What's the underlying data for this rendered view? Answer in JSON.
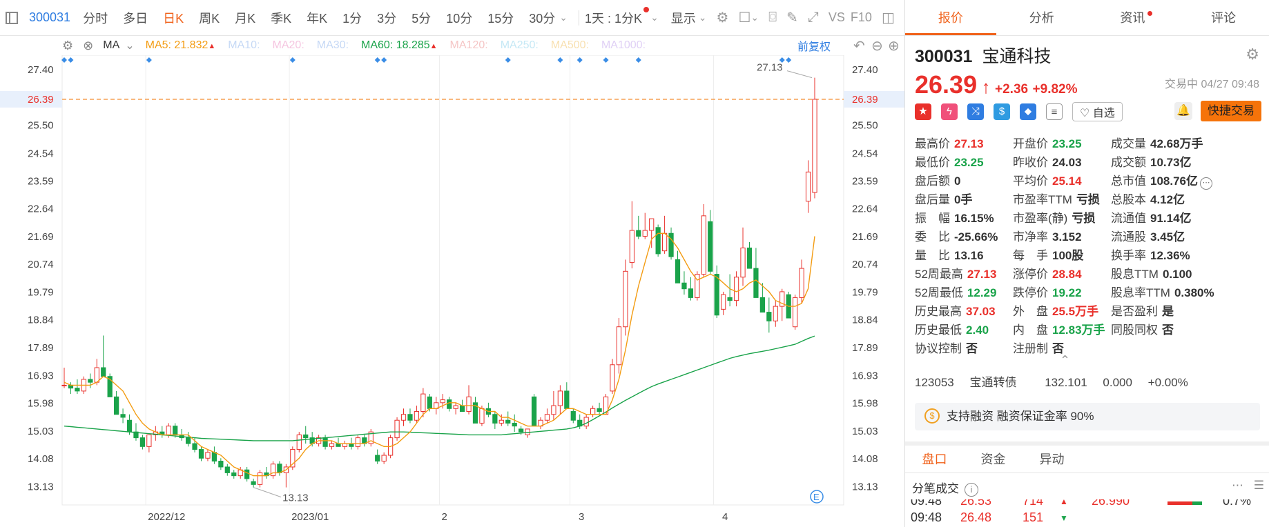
{
  "toolbar": {
    "code": "300031",
    "tabs": [
      "分时",
      "多日",
      "日K",
      "周K",
      "月K",
      "季K",
      "年K",
      "1分",
      "3分",
      "5分",
      "10分",
      "15分",
      "30分"
    ],
    "active_tab": "日K",
    "period_select": "1天 : 1分K",
    "display_label": "显示",
    "vs_label": "VS",
    "f10_label": "F10"
  },
  "ma_bar": {
    "ma_label": "MA",
    "items": [
      {
        "label": "MA5:",
        "value": "21.832",
        "color": "#f39c12",
        "arrow": "▲"
      },
      {
        "label": "MA10:",
        "value": "",
        "color": "#c5d8f5",
        "arrow": ""
      },
      {
        "label": "MA20:",
        "value": "",
        "color": "#f5c5e0",
        "arrow": ""
      },
      {
        "label": "MA30:",
        "value": "",
        "color": "#c5d8f5",
        "arrow": ""
      },
      {
        "label": "MA60:",
        "value": "18.285",
        "color": "#1aa34a",
        "arrow": "▲"
      },
      {
        "label": "MA120:",
        "value": "",
        "color": "#f5c5c5",
        "arrow": ""
      },
      {
        "label": "MA250:",
        "value": "",
        "color": "#c5e8f5",
        "arrow": ""
      },
      {
        "label": "MA500:",
        "value": "",
        "color": "#f8e0b0",
        "arrow": ""
      },
      {
        "label": "MA1000:",
        "value": "",
        "color": "#e0d0f5",
        "arrow": ""
      }
    ],
    "adjust_label": "前复权"
  },
  "chart_data": {
    "type": "candlestick",
    "y_ticks": [
      "27.40",
      "26.39",
      "25.50",
      "24.54",
      "23.59",
      "22.64",
      "21.69",
      "20.74",
      "19.79",
      "18.84",
      "17.89",
      "16.93",
      "15.98",
      "15.03",
      "14.08",
      "13.13"
    ],
    "ylim": [
      12.5,
      27.9
    ],
    "x_labels": [
      "2022/12",
      "2023/01",
      "2",
      "3",
      "4"
    ],
    "current_price": "26.39",
    "max_label": "27.13",
    "min_label": "13.13",
    "candles": [
      [
        16.6,
        17.2,
        16.5,
        16.6
      ],
      [
        16.6,
        16.7,
        16.3,
        16.5
      ],
      [
        16.5,
        16.8,
        16.3,
        16.4
      ],
      [
        16.4,
        16.9,
        16.3,
        16.8
      ],
      [
        16.8,
        17.0,
        16.5,
        16.7
      ],
      [
        16.7,
        17.5,
        16.6,
        17.2
      ],
      [
        17.2,
        18.3,
        16.9,
        16.9
      ],
      [
        16.9,
        17.0,
        16.2,
        16.2
      ],
      [
        16.2,
        16.4,
        15.6,
        15.6
      ],
      [
        15.6,
        15.8,
        15.3,
        15.5
      ],
      [
        15.4,
        15.6,
        14.9,
        15.0
      ],
      [
        15.0,
        15.3,
        14.7,
        14.8
      ],
      [
        14.8,
        14.9,
        14.4,
        14.5
      ],
      [
        14.5,
        14.9,
        14.3,
        14.9
      ],
      [
        14.9,
        15.2,
        14.7,
        15.0
      ],
      [
        15.0,
        15.2,
        14.8,
        14.9
      ],
      [
        14.9,
        15.3,
        14.8,
        15.2
      ],
      [
        15.2,
        15.3,
        14.8,
        14.9
      ],
      [
        14.9,
        15.1,
        14.7,
        14.8
      ],
      [
        14.8,
        15.0,
        14.5,
        14.6
      ],
      [
        14.6,
        14.8,
        14.3,
        14.4
      ],
      [
        14.4,
        14.5,
        14.0,
        14.1
      ],
      [
        14.1,
        14.4,
        14.0,
        14.3
      ],
      [
        14.3,
        14.5,
        13.9,
        14.0
      ],
      [
        14.0,
        14.1,
        13.7,
        13.8
      ],
      [
        13.8,
        13.9,
        13.5,
        13.6
      ],
      [
        13.6,
        13.7,
        13.4,
        13.5
      ],
      [
        13.5,
        13.8,
        13.4,
        13.7
      ],
      [
        13.7,
        13.8,
        13.3,
        13.4
      ],
      [
        13.3,
        13.4,
        13.1,
        13.2
      ],
      [
        13.2,
        13.7,
        13.1,
        13.6
      ],
      [
        13.6,
        13.8,
        13.4,
        13.5
      ],
      [
        13.5,
        14.0,
        13.4,
        13.9
      ],
      [
        13.9,
        14.0,
        13.5,
        13.6
      ],
      [
        13.6,
        13.9,
        13.1,
        13.8
      ],
      [
        13.8,
        14.5,
        13.7,
        14.4
      ],
      [
        14.4,
        15.0,
        14.3,
        14.9
      ],
      [
        14.9,
        15.2,
        14.6,
        14.8
      ],
      [
        14.8,
        15.0,
        14.5,
        14.6
      ],
      [
        14.6,
        14.9,
        14.5,
        14.8
      ],
      [
        14.8,
        14.9,
        14.4,
        14.5
      ],
      [
        14.5,
        14.7,
        14.4,
        14.6
      ],
      [
        14.6,
        14.8,
        14.5,
        14.5
      ],
      [
        14.5,
        14.7,
        14.4,
        14.6
      ],
      [
        14.6,
        14.8,
        14.4,
        14.5
      ],
      [
        14.5,
        14.9,
        14.4,
        14.8
      ],
      [
        14.8,
        14.9,
        14.5,
        14.6
      ],
      [
        14.6,
        15.1,
        14.5,
        15.0
      ],
      [
        14.2,
        14.4,
        13.9,
        14.0
      ],
      [
        14.0,
        14.3,
        13.9,
        14.2
      ],
      [
        14.2,
        14.9,
        14.1,
        14.8
      ],
      [
        14.8,
        15.5,
        14.7,
        15.4
      ],
      [
        15.4,
        15.8,
        15.2,
        15.6
      ],
      [
        15.6,
        15.8,
        15.3,
        15.4
      ],
      [
        15.4,
        15.9,
        15.3,
        15.7
      ],
      [
        15.7,
        16.5,
        15.5,
        16.3
      ],
      [
        16.2,
        16.3,
        15.7,
        15.8
      ],
      [
        15.8,
        16.2,
        15.6,
        16.0
      ],
      [
        16.0,
        16.3,
        15.8,
        16.1
      ],
      [
        16.1,
        16.2,
        15.7,
        15.8
      ],
      [
        15.8,
        16.0,
        15.6,
        15.9
      ],
      [
        15.9,
        16.1,
        15.7,
        15.7
      ],
      [
        15.7,
        16.6,
        15.6,
        16.2
      ],
      [
        16.0,
        16.2,
        15.3,
        15.3
      ],
      [
        15.3,
        15.9,
        15.2,
        15.8
      ],
      [
        15.8,
        16.0,
        15.5,
        15.6
      ],
      [
        15.6,
        15.7,
        15.1,
        15.3
      ],
      [
        15.3,
        15.6,
        15.2,
        15.4
      ],
      [
        15.4,
        15.7,
        15.2,
        15.3
      ],
      [
        15.3,
        15.6,
        15.0,
        15.2
      ],
      [
        15.1,
        15.2,
        14.9,
        15.0
      ],
      [
        14.9,
        15.1,
        14.8,
        15.1
      ],
      [
        16.2,
        16.3,
        15.2,
        15.2
      ],
      [
        15.2,
        15.5,
        15.1,
        15.4
      ],
      [
        15.4,
        15.8,
        15.3,
        15.6
      ],
      [
        15.6,
        16.4,
        15.4,
        15.9
      ],
      [
        15.9,
        16.6,
        15.6,
        16.4
      ],
      [
        16.4,
        16.7,
        15.8,
        15.8
      ],
      [
        15.7,
        15.8,
        15.3,
        15.4
      ],
      [
        15.4,
        15.6,
        15.1,
        15.2
      ],
      [
        15.2,
        15.6,
        15.1,
        15.5
      ],
      [
        15.6,
        15.9,
        15.5,
        15.8
      ],
      [
        15.8,
        16.0,
        15.6,
        15.7
      ],
      [
        15.6,
        16.3,
        15.6,
        16.2
      ],
      [
        16.4,
        17.5,
        16.3,
        17.3
      ],
      [
        17.3,
        18.9,
        17.0,
        18.6
      ],
      [
        18.6,
        20.9,
        18.3,
        20.5
      ],
      [
        20.8,
        22.9,
        20.6,
        21.9
      ],
      [
        21.9,
        22.4,
        21.6,
        21.7
      ],
      [
        21.7,
        22.5,
        21.6,
        21.9
      ],
      [
        21.9,
        22.3,
        21.3,
        22.3
      ],
      [
        22.0,
        22.1,
        21.0,
        21.1
      ],
      [
        21.2,
        22.4,
        21.1,
        21.8
      ],
      [
        21.8,
        22.0,
        20.9,
        21.0
      ],
      [
        20.9,
        21.2,
        20.1,
        20.1
      ],
      [
        20.1,
        20.5,
        19.7,
        19.9
      ],
      [
        19.9,
        20.3,
        19.5,
        19.6
      ],
      [
        19.6,
        20.5,
        19.5,
        20.4
      ],
      [
        20.4,
        22.8,
        20.3,
        22.4
      ],
      [
        22.2,
        22.6,
        20.4,
        20.5
      ],
      [
        20.4,
        20.7,
        18.9,
        19.0
      ],
      [
        19.2,
        19.8,
        19.0,
        19.7
      ],
      [
        19.6,
        20.4,
        19.3,
        19.5
      ],
      [
        19.5,
        20.5,
        19.3,
        20.3
      ],
      [
        20.3,
        22.0,
        20.0,
        21.3
      ],
      [
        21.3,
        21.5,
        20.6,
        20.6
      ],
      [
        20.6,
        21.3,
        19.6,
        19.6
      ],
      [
        19.6,
        20.1,
        19.1,
        19.1
      ],
      [
        19.1,
        19.6,
        18.4,
        18.8
      ],
      [
        18.8,
        19.5,
        18.6,
        19.3
      ],
      [
        19.3,
        19.9,
        18.8,
        19.8
      ],
      [
        19.7,
        19.8,
        18.9,
        18.9
      ],
      [
        18.6,
        19.7,
        18.5,
        19.6
      ],
      [
        19.6,
        20.9,
        19.4,
        20.6
      ],
      [
        22.9,
        24.3,
        22.5,
        23.9
      ],
      [
        23.2,
        27.13,
        23.0,
        26.39
      ]
    ],
    "ma5": [
      16.7,
      16.6,
      16.6,
      16.6,
      16.6,
      16.7,
      16.9,
      16.8,
      16.6,
      16.4,
      16.0,
      15.6,
      15.3,
      15.1,
      15.0,
      14.9,
      14.9,
      14.9,
      14.9,
      14.9,
      14.7,
      14.5,
      14.4,
      14.3,
      14.2,
      14.0,
      13.8,
      13.7,
      13.6,
      13.5,
      13.5,
      13.5,
      13.6,
      13.6,
      13.7,
      13.9,
      14.1,
      14.4,
      14.6,
      14.7,
      14.7,
      14.7,
      14.6,
      14.6,
      14.6,
      14.6,
      14.6,
      14.7,
      14.6,
      14.5,
      14.5,
      14.6,
      14.8,
      15.0,
      15.3,
      15.6,
      15.8,
      15.8,
      15.9,
      16.0,
      16.0,
      15.9,
      15.9,
      15.9,
      15.8,
      15.7,
      15.7,
      15.5,
      15.5,
      15.4,
      15.3,
      15.2,
      15.2,
      15.2,
      15.3,
      15.4,
      15.6,
      15.8,
      15.8,
      15.7,
      15.6,
      15.6,
      15.6,
      15.6,
      16.1,
      16.8,
      17.8,
      19.0,
      20.0,
      20.8,
      21.6,
      21.8,
      21.8,
      21.6,
      21.3,
      20.9,
      20.5,
      20.2,
      20.3,
      20.4,
      20.3,
      20.1,
      19.9,
      19.8,
      19.9,
      20.1,
      20.2,
      20.0,
      19.8,
      19.5,
      19.4,
      19.3,
      19.3,
      19.4,
      19.9,
      21.7
    ],
    "ma60": [
      15.2,
      15.18,
      15.16,
      15.14,
      15.12,
      15.1,
      15.08,
      15.06,
      15.04,
      15.02,
      15.0,
      14.98,
      14.96,
      14.94,
      14.92,
      14.9,
      14.88,
      14.86,
      14.84,
      14.82,
      14.8,
      14.78,
      14.77,
      14.76,
      14.75,
      14.74,
      14.73,
      14.72,
      14.71,
      14.7,
      14.7,
      14.7,
      14.7,
      14.7,
      14.7,
      14.7,
      14.72,
      14.74,
      14.76,
      14.78,
      14.8,
      14.82,
      14.84,
      14.86,
      14.88,
      14.9,
      14.92,
      14.94,
      14.96,
      14.98,
      15.0,
      15.0,
      15.0,
      14.99,
      14.98,
      14.97,
      14.96,
      14.95,
      14.94,
      14.93,
      14.92,
      14.91,
      14.9,
      14.9,
      14.9,
      14.9,
      14.9,
      14.9,
      14.92,
      14.94,
      14.96,
      14.98,
      15.0,
      15.02,
      15.04,
      15.06,
      15.08,
      15.1,
      15.14,
      15.2,
      15.3,
      15.42,
      15.55,
      15.68,
      15.82,
      15.95,
      16.08,
      16.2,
      16.32,
      16.44,
      16.55,
      16.64,
      16.72,
      16.8,
      16.88,
      16.96,
      17.04,
      17.12,
      17.2,
      17.28,
      17.36,
      17.44,
      17.52,
      17.58,
      17.63,
      17.68,
      17.72,
      17.76,
      17.8,
      17.85,
      17.9,
      17.95,
      18.0,
      18.1,
      18.2,
      18.285
    ]
  },
  "panel": {
    "tabs": [
      "报价",
      "分析",
      "资讯",
      "评论"
    ],
    "code": "300031",
    "name": "宝通科技",
    "price": "26.39",
    "arrow": "↑",
    "change": "+2.36",
    "change_pct": "+9.82%",
    "status": "交易中 04/27 09:48",
    "fav_label": "自选",
    "trade_label": "快捷交易",
    "stats": [
      [
        {
          "k": "最高价",
          "v": "27.13",
          "c": "red"
        },
        {
          "k": "开盘价",
          "v": "23.25",
          "c": "green"
        },
        {
          "k": "成交量",
          "v": "42.68万手",
          "c": ""
        }
      ],
      [
        {
          "k": "最低价",
          "v": "23.25",
          "c": "green"
        },
        {
          "k": "昨收价",
          "v": "24.03",
          "c": ""
        },
        {
          "k": "成交额",
          "v": "10.73亿",
          "c": ""
        }
      ],
      [
        {
          "k": "盘后额",
          "v": "0",
          "c": ""
        },
        {
          "k": "平均价",
          "v": "25.14",
          "c": "red"
        },
        {
          "k": "总市值",
          "v": "108.76亿",
          "c": ""
        }
      ],
      [
        {
          "k": "盘后量",
          "v": "0手",
          "c": ""
        },
        {
          "k": "市盈率TTM",
          "v": "亏损",
          "c": ""
        },
        {
          "k": "总股本",
          "v": "4.12亿",
          "c": ""
        }
      ],
      [
        {
          "k": "振　幅",
          "v": "16.15%",
          "c": ""
        },
        {
          "k": "市盈率(静)",
          "v": "亏损",
          "c": ""
        },
        {
          "k": "流通值",
          "v": "91.14亿",
          "c": ""
        }
      ],
      [
        {
          "k": "委　比",
          "v": "-25.66%",
          "c": ""
        },
        {
          "k": "市净率",
          "v": "3.152",
          "c": ""
        },
        {
          "k": "流通股",
          "v": "3.45亿",
          "c": ""
        }
      ],
      [
        {
          "k": "量　比",
          "v": "13.16",
          "c": ""
        },
        {
          "k": "每　手",
          "v": "100股",
          "c": ""
        },
        {
          "k": "换手率",
          "v": "12.36%",
          "c": ""
        }
      ],
      [
        {
          "k": "52周最高",
          "v": "27.13",
          "c": "red"
        },
        {
          "k": "涨停价",
          "v": "28.84",
          "c": "red"
        },
        {
          "k": "股息TTM",
          "v": "0.100",
          "c": ""
        }
      ],
      [
        {
          "k": "52周最低",
          "v": "12.29",
          "c": "green"
        },
        {
          "k": "跌停价",
          "v": "19.22",
          "c": "green"
        },
        {
          "k": "股息率TTM",
          "v": "0.380%",
          "c": ""
        }
      ],
      [
        {
          "k": "历史最高",
          "v": "37.03",
          "c": "red"
        },
        {
          "k": "外　盘",
          "v": "25.5万手",
          "c": "red"
        },
        {
          "k": "是否盈利",
          "v": "是",
          "c": ""
        }
      ],
      [
        {
          "k": "历史最低",
          "v": "2.40",
          "c": "green"
        },
        {
          "k": "内　盘",
          "v": "12.83万手",
          "c": "green"
        },
        {
          "k": "同股同权",
          "v": "否",
          "c": ""
        }
      ],
      [
        {
          "k": "协议控制",
          "v": "否",
          "c": ""
        },
        {
          "k": "注册制",
          "v": "否",
          "c": ""
        },
        {
          "k": "",
          "v": "",
          "c": ""
        }
      ]
    ],
    "bond": {
      "code": "123053",
      "name": "宝通转债",
      "price": "132.101",
      "chg": "0.000",
      "pct": "+0.00%"
    },
    "margin_text": "支持融资 融资保证金率 90%",
    "bottom_tabs": [
      "盘口",
      "资金",
      "异动"
    ],
    "tick_title": "分笔成交",
    "ticks": [
      {
        "time": "09:48",
        "price": "26.53",
        "vol": "714",
        "dir": "▲",
        "mid": "26.990",
        "pct": "0.7%"
      },
      {
        "time": "09:48",
        "price": "26.48",
        "vol": "151",
        "dir": "▼",
        "mid": "",
        "pct": ""
      }
    ]
  },
  "colors": {
    "up": "#e9302b",
    "down": "#1aa34a",
    "accent": "#f0621b",
    "ma5": "#f39c12",
    "ma60": "#1aa34a",
    "link": "#2f7de1"
  }
}
